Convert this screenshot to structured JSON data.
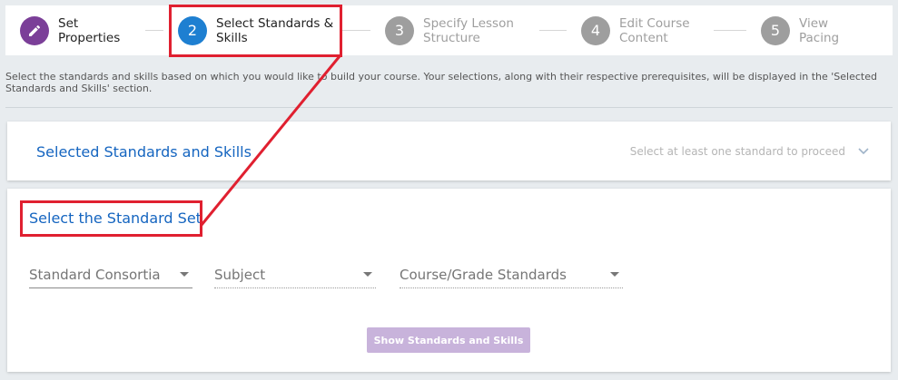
{
  "stepper": {
    "steps": [
      {
        "number": "",
        "icon": "pencil-icon",
        "line1": "Set",
        "line2": "Properties",
        "state": "done"
      },
      {
        "number": "2",
        "line1": "Select Standards &",
        "line2": "Skills",
        "state": "active"
      },
      {
        "number": "3",
        "line1": "Specify Lesson",
        "line2": "Structure",
        "state": "todo"
      },
      {
        "number": "4",
        "line1": "Edit Course",
        "line2": "Content",
        "state": "todo"
      },
      {
        "number": "5",
        "line1": "View",
        "line2": "Pacing",
        "state": "todo"
      }
    ]
  },
  "intro": "Select the standards and skills based on which you would like to build your course. Your selections, along with their respective prerequisites, will be displayed in the 'Selected Standards and Skills' section.",
  "selected_panel": {
    "title": "Selected Standards and Skills",
    "hint": "Select at least one standard to proceed"
  },
  "standard_set": {
    "title": "Select the Standard Set",
    "dropdowns": {
      "consortia": "Standard Consortia",
      "subject": "Subject",
      "course": "Course/Grade Standards"
    },
    "button": "Show Standards and Skills"
  },
  "colors": {
    "done": "#7b3f98",
    "active": "#1e7fd1",
    "todo": "#9e9e9e",
    "link": "#1565c0",
    "highlight": "#e02030",
    "button_disabled": "#c8b3db"
  }
}
